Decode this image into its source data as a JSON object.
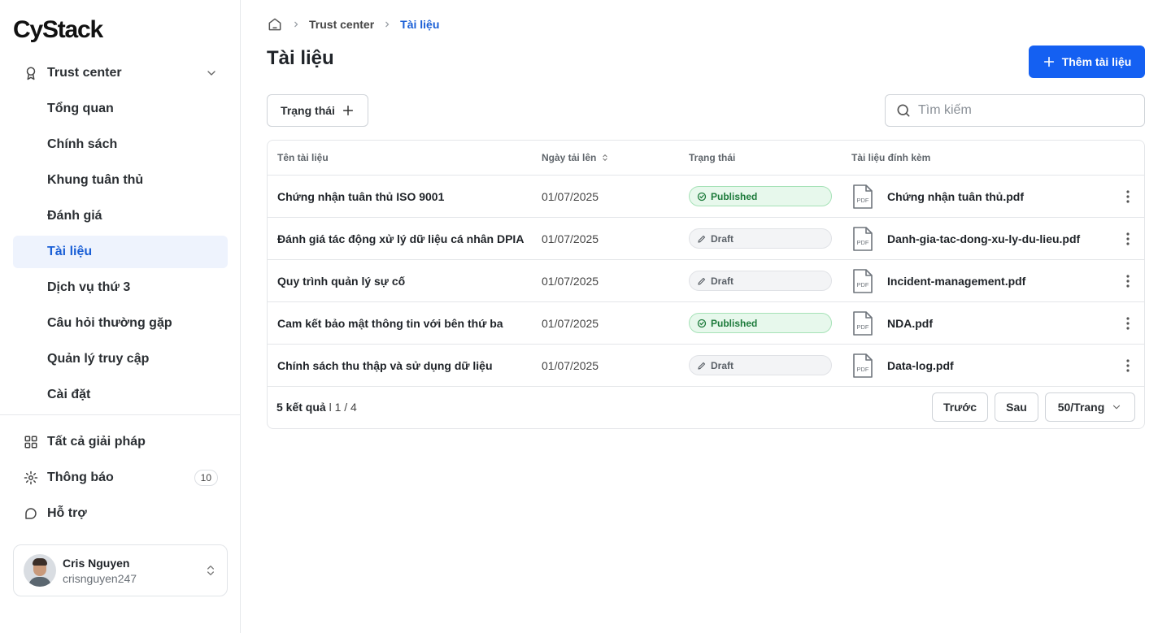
{
  "brand": {
    "logo": "CyStack"
  },
  "sidebar": {
    "group": {
      "label": "Trust center",
      "icon": "award-icon"
    },
    "items": [
      {
        "label": "Tổng quan"
      },
      {
        "label": "Chính sách"
      },
      {
        "label": "Khung tuân thủ"
      },
      {
        "label": "Đánh giá"
      },
      {
        "label": "Tài liệu",
        "active": true
      },
      {
        "label": "Dịch vụ thứ 3"
      },
      {
        "label": "Câu hỏi thường gặp"
      },
      {
        "label": "Quản lý truy cập"
      },
      {
        "label": "Cài đặt"
      }
    ],
    "bottom": [
      {
        "label": "Tất cả giải pháp",
        "icon": "grid-icon"
      },
      {
        "label": "Thông báo",
        "icon": "gear-icon",
        "badge": "10"
      },
      {
        "label": "Hỗ trợ",
        "icon": "support-chat-icon"
      }
    ],
    "user": {
      "name": "Cris Nguyen",
      "handle": "crisnguyen247"
    }
  },
  "breadcrumb": [
    "Trust center",
    "Tài liệu"
  ],
  "page": {
    "title": "Tài liệu",
    "add_button": "Thêm tài liệu",
    "filter_button": "Trạng thái",
    "search_placeholder": "Tìm kiếm"
  },
  "table": {
    "headers": [
      "Tên tài liệu",
      "Ngày tải lên",
      "Trạng thái",
      "Tài liệu đính kèm"
    ],
    "rows": [
      {
        "name": "Chứng nhận tuân thủ ISO 9001",
        "date": "01/07/2025",
        "status": "Published",
        "file": "Chứng nhận tuân thủ.pdf"
      },
      {
        "name": "Đánh giá tác động xử lý dữ liệu cá nhân DPIA",
        "date": "01/07/2025",
        "status": "Draft",
        "file": "Danh-gia-tac-dong-xu-ly-du-lieu.pdf"
      },
      {
        "name": "Quy trình quản lý sự cố",
        "date": "01/07/2025",
        "status": "Draft",
        "file": "Incident-management.pdf"
      },
      {
        "name": "Cam kết bảo mật thông tin với bên thứ ba",
        "date": "01/07/2025",
        "status": "Published",
        "file": "NDA.pdf"
      },
      {
        "name": "Chính sách thu thập và sử dụng dữ liệu",
        "date": "01/07/2025",
        "status": "Draft",
        "file": "Data-log.pdf"
      }
    ],
    "pdf_label": "PDF"
  },
  "pagination": {
    "results": "5 kết quả",
    "pages": "l 1 / 4",
    "prev": "Trước",
    "next": "Sau",
    "per_page": "50/Trang"
  },
  "colors": {
    "accent": "#1460f2",
    "published_bg": "#e7f8ec",
    "published_text": "#1c7a3a",
    "active_nav_bg": "#eef3fd"
  }
}
